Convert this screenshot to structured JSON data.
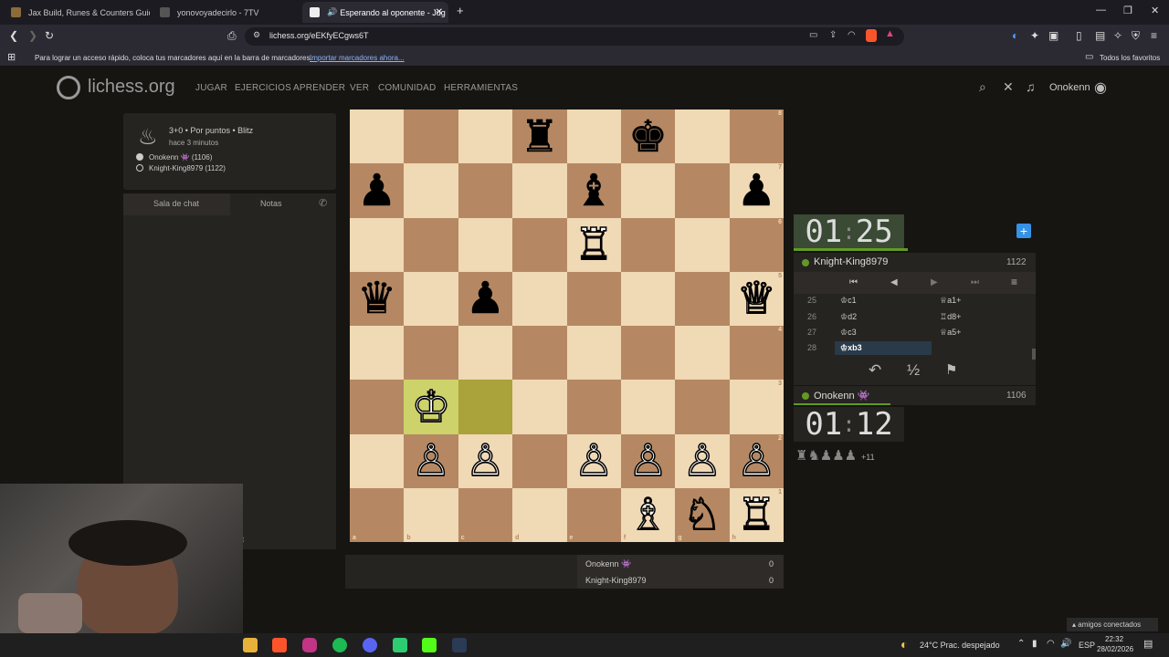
{
  "tabs": [
    {
      "title": "Jax Build, Runes & Counters Guide fo",
      "color": "#8c6b3a"
    },
    {
      "title": "yonovoyadecirlo - 7TV",
      "color": "#333"
    },
    {
      "title": "Esperando al oponente - Jug",
      "color": "#eee",
      "active": true
    }
  ],
  "browser": {
    "url": "lichess.org/eEKfyECgws6T",
    "bookmark_hint": "Para lograr un acceso rápido, coloca tus marcadores aquí en la barra de marcadores.",
    "import_link": "Importar marcadores ahora...",
    "all_favorites": "Todos los favoritos"
  },
  "site": {
    "logo": "lichess.org",
    "nav": [
      "JUGAR",
      "EJERCICIOS",
      "APRENDER",
      "VER",
      "COMUNIDAD",
      "HERRAMIENTAS"
    ],
    "username": "Onokenn"
  },
  "game": {
    "mode": "3+0 • Por puntos • Blitz",
    "time_ago": "hace 3 minutos",
    "white_player": "Onokenn 👾 (1106)",
    "black_player": "Knight-King8979 (1122)"
  },
  "chat": {
    "tab_chat": "Sala de chat",
    "tab_notes": "Notas",
    "stray_letter": "t"
  },
  "board": {
    "ranks": [
      "8",
      "7",
      "6",
      "5",
      "4",
      "3",
      "2",
      "1"
    ],
    "files": [
      "a",
      "b",
      "c",
      "d",
      "e",
      "f",
      "g",
      "h"
    ],
    "pieces": [
      [
        "",
        "",
        "",
        "♜",
        "",
        "♚",
        "",
        ""
      ],
      [
        "♟",
        "",
        "",
        "",
        "♝",
        "",
        "",
        "♟"
      ],
      [
        "",
        "",
        "",
        "",
        "♖",
        "",
        "",
        ""
      ],
      [
        "♛",
        "",
        "♟",
        "",
        "",
        "",
        "",
        "♕"
      ],
      [
        "",
        "",
        "",
        "",
        "",
        "",
        "",
        ""
      ],
      [
        "",
        "♔",
        "",
        "",
        "",
        "",
        "",
        ""
      ],
      [
        "",
        "♙",
        "♙",
        "",
        "♙",
        "♙",
        "♙",
        "♙"
      ],
      [
        "",
        "",
        "",
        "",
        "",
        "♗",
        "♘",
        "♖"
      ]
    ],
    "colors": [
      [
        "w",
        "w",
        "w",
        "b",
        "w",
        "b",
        "w",
        "w"
      ],
      [
        "b",
        "w",
        "w",
        "w",
        "b",
        "w",
        "w",
        "b"
      ],
      [
        "w",
        "w",
        "w",
        "w",
        "w",
        "w",
        "w",
        "w"
      ],
      [
        "b",
        "w",
        "b",
        "w",
        "w",
        "w",
        "w",
        "w"
      ],
      [
        "w",
        "w",
        "w",
        "w",
        "w",
        "w",
        "w",
        "w"
      ],
      [
        "w",
        "w",
        "w",
        "w",
        "w",
        "w",
        "w",
        "w"
      ],
      [
        "w",
        "w",
        "w",
        "w",
        "w",
        "w",
        "w",
        "w"
      ],
      [
        "w",
        "w",
        "w",
        "w",
        "w",
        "w",
        "w",
        "w"
      ]
    ],
    "highlights": [
      "b3",
      "c3"
    ]
  },
  "scores": [
    {
      "name": "Onokenn 👾",
      "score": "0"
    },
    {
      "name": "Knight-King8979",
      "score": "0"
    }
  ],
  "clocks": {
    "top": [
      "01",
      "25"
    ],
    "bottom": [
      "01",
      "12"
    ]
  },
  "opponent": {
    "name": "Knight-King8979",
    "rating": "1122"
  },
  "me": {
    "name": "Onokenn 👾",
    "rating": "1106"
  },
  "moves": [
    {
      "n": "25",
      "w": "♔c1",
      "b": "♕a1+"
    },
    {
      "n": "26",
      "w": "♔d2",
      "b": "♖d8+"
    },
    {
      "n": "27",
      "w": "♔c3",
      "b": "♕a5+"
    },
    {
      "n": "28",
      "w": "♔xb3",
      "b": ""
    }
  ],
  "material": {
    "pieces": "♜♞♟♟♟",
    "diff": "+11"
  },
  "taskbar": {
    "weather": "24°C  Prac. despejado",
    "lang": "ESP",
    "time": "22:32",
    "date": "28/02/2026",
    "friends": "amigos conectados"
  }
}
